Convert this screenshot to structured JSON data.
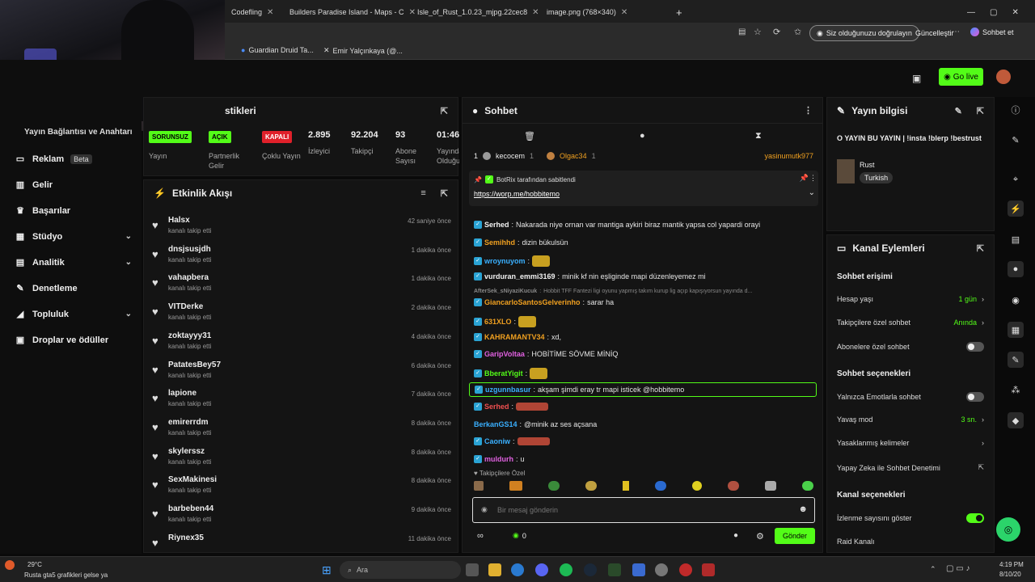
{
  "browser": {
    "tabs": [
      {
        "label": "Codefling"
      },
      {
        "label": "Builders Paradise Island - Maps - C"
      },
      {
        "label": "Isle_of_Rust_1.0.23_mjpg.22cec8"
      },
      {
        "label": "image.png (768×340)"
      }
    ],
    "verify_label": "Siz olduğunuzu doğrulayın",
    "update_label": "Güncelleştir",
    "chat_label": "Sohbet et",
    "bookmarks": [
      {
        "label": "Guardian Druid Ta..."
      },
      {
        "label": "Emir Yalçınkaya (@..."
      }
    ]
  },
  "header": {
    "go_live": "Go live"
  },
  "sidebar": {
    "partial_title": "Yayın Bağlantısı ve Anahtarı",
    "items": [
      {
        "label": "Reklam",
        "badge": "Beta"
      },
      {
        "label": "Gelir"
      },
      {
        "label": "Başarılar"
      },
      {
        "label": "Stüdyo"
      },
      {
        "label": "Analitik"
      },
      {
        "label": "Denetleme"
      },
      {
        "label": "Topluluk"
      },
      {
        "label": "Droplar ve ödüller"
      }
    ]
  },
  "stats": {
    "title": "stikleri",
    "items": [
      {
        "tag": "SORUNSUZ",
        "label": "Yayın",
        "color": "#53fc18"
      },
      {
        "tag": "AÇIK",
        "label": "Partnerlik Gelir",
        "color": "#53fc18"
      },
      {
        "tag": "KAPALI",
        "label": "Çoklu Yayın",
        "color": "#e0202a"
      },
      {
        "value": "2.895",
        "label": "İzleyici"
      },
      {
        "value": "92.204",
        "label": "Takipçi"
      },
      {
        "value": "93",
        "label": "Abone Sayısı"
      },
      {
        "value": "01:46:",
        "label": "Yayında Olduğu"
      }
    ]
  },
  "activity": {
    "title": "Etkinlik Akışı",
    "items": [
      {
        "name": "Halsx",
        "sub": "kanalı takip etti",
        "time": "42 saniye önce"
      },
      {
        "name": "dnsjsusjdh",
        "sub": "kanalı takip etti",
        "time": "1 dakika önce"
      },
      {
        "name": "vahapbera",
        "sub": "kanalı takip etti",
        "time": "1 dakika önce"
      },
      {
        "name": "VITDerke",
        "sub": "kanalı takip etti",
        "time": "2 dakika önce"
      },
      {
        "name": "zoktayyy31",
        "sub": "kanalı takip etti",
        "time": "4 dakika önce"
      },
      {
        "name": "PatatesBey57",
        "sub": "kanalı takip etti",
        "time": "6 dakika önce"
      },
      {
        "name": "lapione",
        "sub": "kanalı takip etti",
        "time": "7 dakika önce"
      },
      {
        "name": "emirerrdm",
        "sub": "kanalı takip etti",
        "time": "8 dakika önce"
      },
      {
        "name": "skylerssz",
        "sub": "kanalı takip etti",
        "time": "8 dakika önce"
      },
      {
        "name": "SexMakinesi",
        "sub": "kanalı takip etti",
        "time": "8 dakika önce"
      },
      {
        "name": "barbeben44",
        "sub": "kanalı takip etti",
        "time": "9 dakika önce"
      },
      {
        "name": "Riynex35",
        "sub": "",
        "time": "11 dakika önce"
      }
    ]
  },
  "chat": {
    "title": "Sohbet",
    "leaders": [
      {
        "rank": "1",
        "name": "kecocem",
        "count": "1"
      },
      {
        "name": "Olgac34",
        "count": "1"
      },
      {
        "name": "yasinumutk977"
      }
    ],
    "pinned": {
      "by": "BotRix tarafından sabitlendi",
      "link": "https://worp.me/hobbitemo"
    },
    "messages": [
      {
        "user": "Serhed",
        "color": "#f2f2f2",
        "text": "Nakarada niye ornan var mantiga aykiri biraz mantik yapsa col yapardi orayi"
      },
      {
        "user": "Semihhd",
        "color": "#f0a020",
        "text": "dizin bükulsün"
      },
      {
        "user": "wroynuyom",
        "color": "#3ab0ff",
        "text": ""
      },
      {
        "user": "vurduran_emmi3169",
        "color": "#f2f2f2",
        "text": "minik kf nin eşliginde mapi düzenleyemez mi"
      },
      {
        "user": "AfterSek_sNiyaziKucuk",
        "color": "#888",
        "text": "Hobbit TFF Fantezi ligi oyunu yapmış takım kurup lig açıp kapışıyorsun yayında d..."
      },
      {
        "user": "GiancarloSantosGelverinho",
        "color": "#f0a020",
        "text": "sarar ha"
      },
      {
        "user": "631XLO",
        "color": "#f0a020",
        "text": ""
      },
      {
        "user": "KAHRAMANTV34",
        "color": "#f0a020",
        "text": "xd,"
      },
      {
        "user": "GaripVoltaa",
        "color": "#e060e0",
        "text": "HOBİTİME SÖVME MİNİQ"
      },
      {
        "user": "BberatYigit",
        "color": "#53fc18",
        "text": ""
      },
      {
        "user": "uzgunnbasur",
        "color": "#3ab0ff",
        "text": "akşam şimdi eray tr mapi isticek @hobbitemo"
      },
      {
        "user": "Serhed",
        "color": "#f05050",
        "text": ""
      },
      {
        "user": "BerkanGS14",
        "color": "#3ab0ff",
        "text": "@minik az ses açsana"
      },
      {
        "user": "Caoniw",
        "color": "#3ab0ff",
        "text": ""
      },
      {
        "user": "muldurh",
        "color": "#e060e0",
        "text": "u"
      }
    ],
    "followers_only": "Takipçilere Özel",
    "placeholder": "Bir mesaj gönderin",
    "send": "Gönder",
    "count": "0"
  },
  "stream_info": {
    "title": "Yayın bilgisi",
    "stream_title": "O YAYIN BU YAYIN | !insta !blerp !bestrust",
    "category": "Rust",
    "tag": "Turkish"
  },
  "channel_actions": {
    "title": "Kanal Eylemleri",
    "chat_access": "Sohbet erişimi",
    "rows1": [
      {
        "label": "Hesap yaşı",
        "value": "1 gün"
      },
      {
        "label": "Takipçilere özel sohbet",
        "value": "Anında"
      },
      {
        "label": "Abonelere özel sohbet",
        "toggle": false
      }
    ],
    "chat_options": "Sohbet seçenekleri",
    "rows2": [
      {
        "label": "Yalnızca Emotlarla sohbet",
        "toggle": false
      },
      {
        "label": "Yavaş mod",
        "value": "3 sn."
      },
      {
        "label": "Yasaklanmış kelimeler"
      },
      {
        "label": "Yapay Zeka ile Sohbet Denetimi"
      }
    ],
    "channel_options": "Kanal seçenekleri",
    "rows3": [
      {
        "label": "İzlenme sayısını göster",
        "toggle": true
      },
      {
        "label": "Raid Kanalı"
      }
    ]
  },
  "taskbar": {
    "weather_temp": "29°C",
    "weather_text": "Rusta gta5 grafikleri gelse ya",
    "search": "Ara",
    "time": "4:19 PM",
    "date": "8/10/20"
  }
}
